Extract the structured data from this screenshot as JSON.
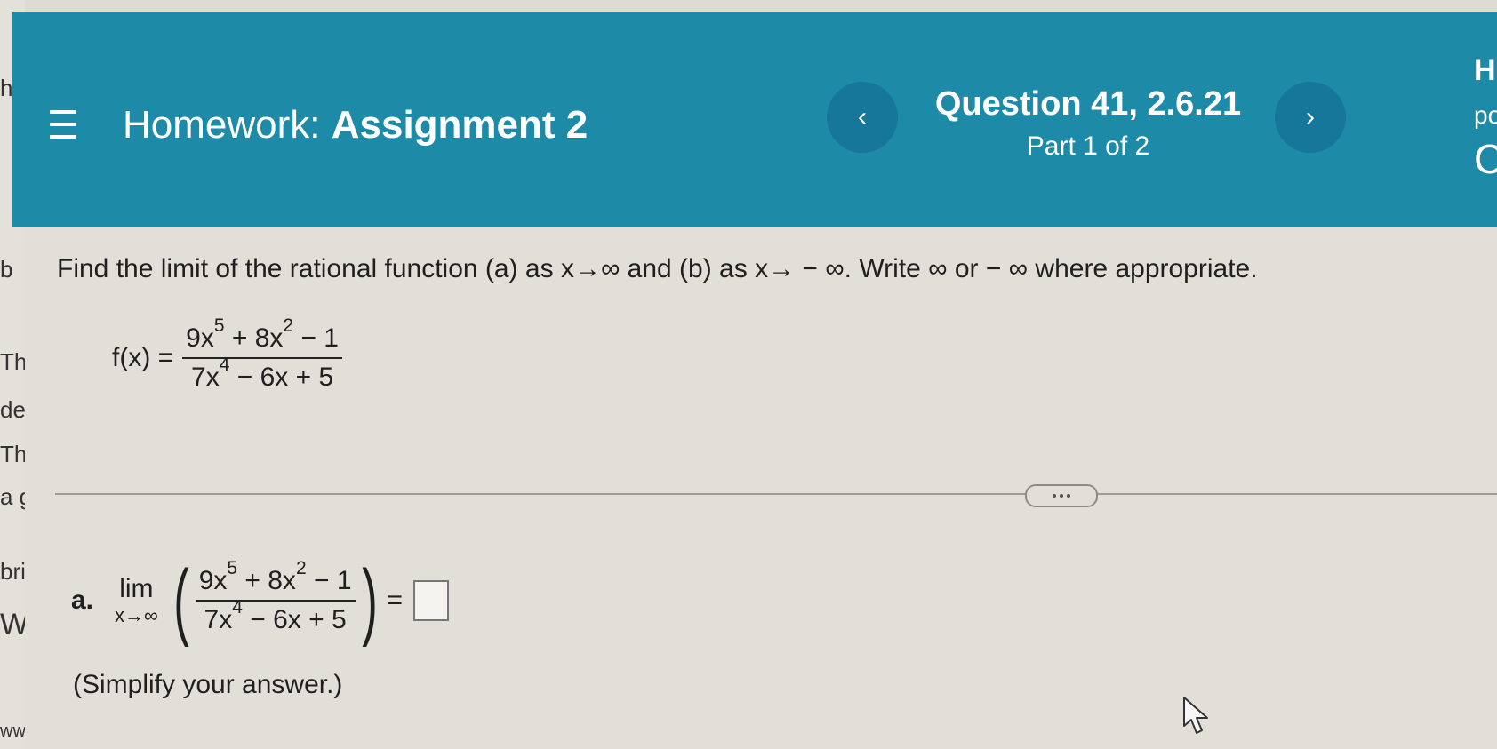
{
  "left_strip": {
    "fragments": [
      "h",
      "b",
      "Th",
      "de",
      "Th",
      "a g",
      "bri",
      "W",
      "ww"
    ]
  },
  "header": {
    "title_prefix": "Homework:",
    "title_main": "Assignment 2",
    "prev_symbol": "‹",
    "next_symbol": "›",
    "question_title": "Question 41, 2.6.21",
    "question_part": "Part 1 of 2",
    "right_fragments": [
      "H",
      "po",
      "C"
    ],
    "background": "#1d8aa8"
  },
  "question": {
    "prompt": "Find the limit of the rational function (a) as x→∞ and (b) as x→ − ∞. Write ∞ or − ∞ where appropriate.",
    "function_lhs": "f(x) =",
    "numerator": {
      "t1": "9x",
      "e1": "5",
      "t2": " + 8x",
      "e2": "2",
      "t3": " − 1"
    },
    "denominator": {
      "t1": "7x",
      "e1": "4",
      "t2": " − 6x + 5"
    }
  },
  "part_a": {
    "label": "a.",
    "lim_word": "lim",
    "lim_sub": "x→∞",
    "equals": "=",
    "answer_value": "",
    "hint": "(Simplify your answer.)"
  },
  "icons": [
    "menu-icon",
    "chevron-left-icon",
    "chevron-right-icon",
    "more-options-icon",
    "mouse-cursor-icon"
  ]
}
